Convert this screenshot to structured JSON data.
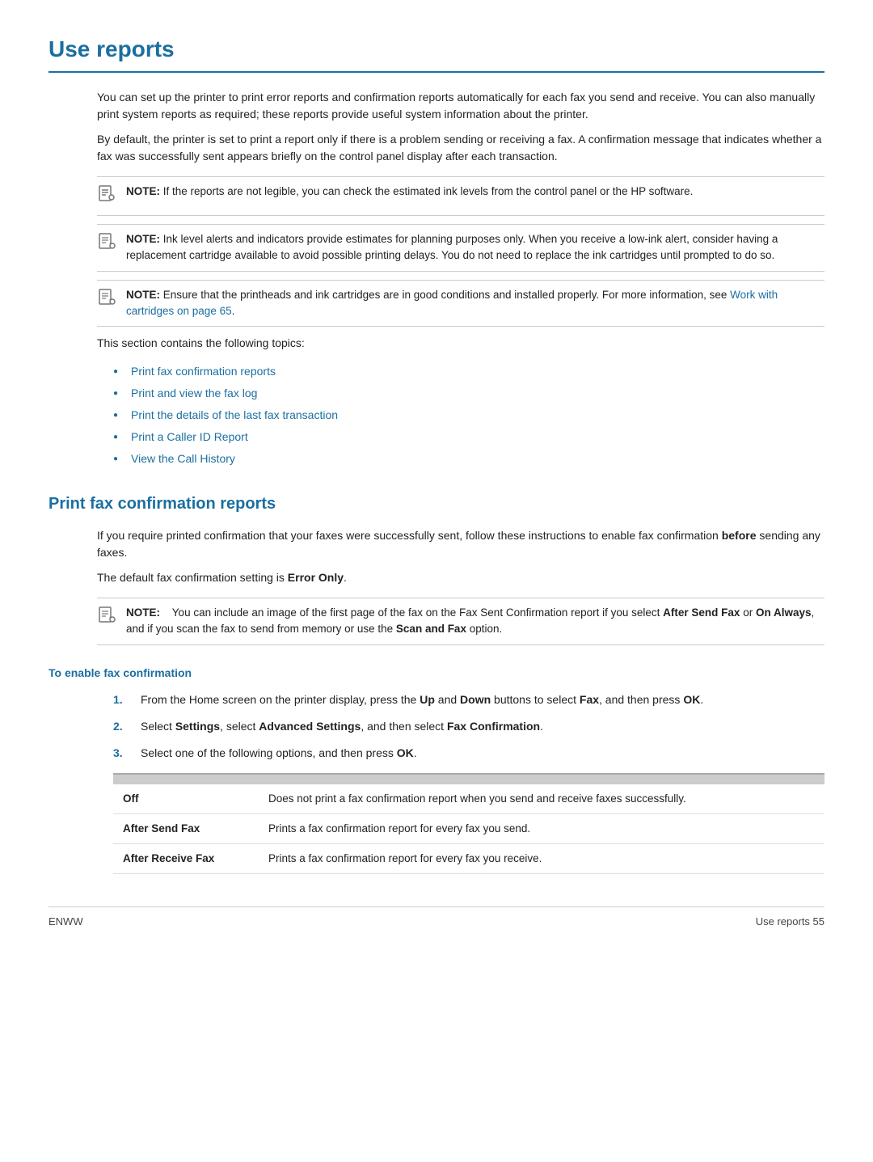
{
  "page": {
    "title": "Use reports",
    "footer_left": "ENWW",
    "footer_right": "Use reports     55"
  },
  "intro": {
    "para1": "You can set up the printer to print error reports and confirmation reports automatically for each fax you send and receive. You can also manually print system reports as required; these reports provide useful system information about the printer.",
    "para2": "By default, the printer is set to print a report only if there is a problem sending or receiving a fax. A confirmation message that indicates whether a fax was successfully sent appears briefly on the control panel display after each transaction."
  },
  "notes": [
    {
      "id": "note1",
      "label": "NOTE:",
      "text": "If the reports are not legible, you can check the estimated ink levels from the control panel or the HP software."
    },
    {
      "id": "note2",
      "label": "NOTE:",
      "text": "Ink level alerts and indicators provide estimates for planning purposes only. When you receive a low-ink alert, consider having a replacement cartridge available to avoid possible printing delays. You do not need to replace the ink cartridges until prompted to do so."
    },
    {
      "id": "note3",
      "label": "NOTE:",
      "text": "Ensure that the printheads and ink cartridges are in good conditions and installed properly. For more information, see ",
      "link_text": "Work with cartridges on page 65",
      "link_href": "#"
    }
  ],
  "topics_intro": "This section contains the following topics:",
  "topics": [
    {
      "label": "Print fax confirmation reports",
      "href": "#print-fax"
    },
    {
      "label": "Print and view the fax log",
      "href": "#fax-log"
    },
    {
      "label": "Print the details of the last fax transaction",
      "href": "#last-fax"
    },
    {
      "label": "Print a Caller ID Report",
      "href": "#caller-id"
    },
    {
      "label": "View the Call History",
      "href": "#call-history"
    }
  ],
  "section_print_fax": {
    "title": "Print fax confirmation reports",
    "para1": "If you require printed confirmation that your faxes were successfully sent, follow these instructions to enable fax confirmation ",
    "para1_bold": "before",
    "para1_end": " sending any faxes.",
    "para2_prefix": "The default fax confirmation setting is ",
    "para2_bold": "Error Only",
    "para2_end": ".",
    "note": {
      "label": "NOTE:",
      "text_prefix": "You can include an image of the first page of the fax on the Fax Sent Confirmation report if you select ",
      "bold1": "After Send Fax",
      "text_mid1": " or ",
      "bold2": "On Always",
      "text_mid2": ", and if you scan the fax to send from memory or use the ",
      "bold3": "Scan and Fax",
      "text_end": " option."
    }
  },
  "subsection_enable": {
    "title": "To enable fax confirmation",
    "steps": [
      {
        "num": "1.",
        "text_prefix": "From the Home screen on the printer display, press the ",
        "bold1": "Up",
        "text_mid1": " and ",
        "bold2": "Down",
        "text_mid2": " buttons to select ",
        "bold3": "Fax",
        "text_end": ", and then press ",
        "bold4": "OK",
        "text_final": "."
      },
      {
        "num": "2.",
        "text_prefix": "Select ",
        "bold1": "Settings",
        "text_mid1": ", select ",
        "bold2": "Advanced Settings",
        "text_mid2": ", and then select ",
        "bold3": "Fax Confirmation",
        "text_end": "."
      },
      {
        "num": "3.",
        "text_prefix": "Select one of the following options, and then press ",
        "bold1": "OK",
        "text_end": "."
      }
    ]
  },
  "options_table": {
    "rows": [
      {
        "option": "Off",
        "description": "Does not print a fax confirmation report when you send and receive faxes successfully."
      },
      {
        "option": "After Send Fax",
        "description": "Prints a fax confirmation report for every fax you send."
      },
      {
        "option": "After Receive Fax",
        "description": "Prints a fax confirmation report for every fax you receive."
      }
    ]
  }
}
